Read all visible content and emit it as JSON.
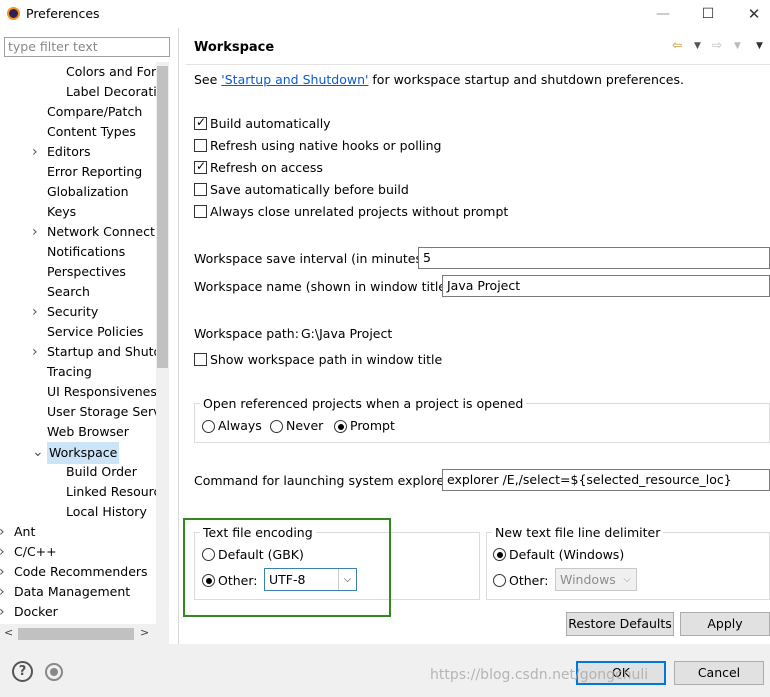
{
  "window": {
    "title": "Preferences",
    "min": "—",
    "max": "☐",
    "close": "✕"
  },
  "filter": {
    "placeholder": "type filter text"
  },
  "tree": {
    "items": [
      {
        "label": "Colors and For",
        "level": 2
      },
      {
        "label": "Label Decoratio",
        "level": 2
      },
      {
        "label": "Compare/Patch",
        "level": 1
      },
      {
        "label": "Content Types",
        "level": 1
      },
      {
        "label": "Editors",
        "level": 1,
        "arrow": ">"
      },
      {
        "label": "Error Reporting",
        "level": 1
      },
      {
        "label": "Globalization",
        "level": 1
      },
      {
        "label": "Keys",
        "level": 1
      },
      {
        "label": "Network Connectic",
        "level": 1,
        "arrow": ">"
      },
      {
        "label": "Notifications",
        "level": 1
      },
      {
        "label": "Perspectives",
        "level": 1
      },
      {
        "label": "Search",
        "level": 1
      },
      {
        "label": "Security",
        "level": 1,
        "arrow": ">"
      },
      {
        "label": "Service Policies",
        "level": 1
      },
      {
        "label": "Startup and Shutd",
        "level": 1,
        "arrow": ">"
      },
      {
        "label": "Tracing",
        "level": 1
      },
      {
        "label": "UI Responsiveness",
        "level": 1
      },
      {
        "label": "User Storage Serv",
        "level": 1
      },
      {
        "label": "Web Browser",
        "level": 1
      },
      {
        "label": "Workspace",
        "level": 1,
        "arrow": "v",
        "selected": true
      },
      {
        "label": "Build Order",
        "level": 2
      },
      {
        "label": "Linked Resourc",
        "level": 2
      },
      {
        "label": "Local History",
        "level": 2
      },
      {
        "label": "Ant",
        "level": 0,
        "arrow": ">"
      },
      {
        "label": "C/C++",
        "level": 0,
        "arrow": ">"
      },
      {
        "label": "Code Recommenders",
        "level": 0,
        "arrow": ">"
      },
      {
        "label": "Data Management",
        "level": 0,
        "arrow": ">"
      },
      {
        "label": "Docker",
        "level": 0,
        "arrow": ">"
      }
    ]
  },
  "page": {
    "title": "Workspace",
    "intro_prefix": "See ",
    "intro_link": "'Startup and Shutdown'",
    "intro_suffix": " for workspace startup and shutdown preferences.",
    "checkboxes": [
      {
        "label": "Build automatically",
        "checked": true
      },
      {
        "label": "Refresh using native hooks or polling",
        "checked": false
      },
      {
        "label": "Refresh on access",
        "checked": true
      },
      {
        "label": "Save automatically before build",
        "checked": false
      },
      {
        "label": "Always close unrelated projects without prompt",
        "checked": false
      }
    ],
    "save_interval_label": "Workspace save interval (in minutes):",
    "save_interval_value": "5",
    "workspace_name_label": "Workspace name (shown in window title):",
    "workspace_name_value": "Java Project",
    "workspace_path_label": "Workspace path:",
    "workspace_path_value": "G:\\Java Project",
    "show_path_label": "Show workspace path in window title",
    "open_projects": {
      "title": "Open referenced projects when a project is opened",
      "options": [
        "Always",
        "Never",
        "Prompt"
      ],
      "selected": "Prompt"
    },
    "explorer_label": "Command for launching system explorer:",
    "explorer_value": "explorer /E,/select=${selected_resource_loc}",
    "encoding": {
      "title": "Text file encoding",
      "default_label": "Default (GBK)",
      "other_label": "Other:",
      "other_value": "UTF-8",
      "selected": "Other"
    },
    "delimiter": {
      "title": "New text file line delimiter",
      "default_label": "Default (Windows)",
      "other_label": "Other:",
      "other_value": "Windows",
      "selected": "Default"
    },
    "restore_defaults": "Restore Defaults",
    "apply": "Apply"
  },
  "footer": {
    "ok": "OK",
    "cancel": "Cancel",
    "help_icon": "?"
  },
  "watermark": "https://blog.csdn.net/gongchuli",
  "colors": {
    "highlight_box": "#2e8a1e",
    "selection": "#cce4f7",
    "link": "#0b5ad1"
  }
}
